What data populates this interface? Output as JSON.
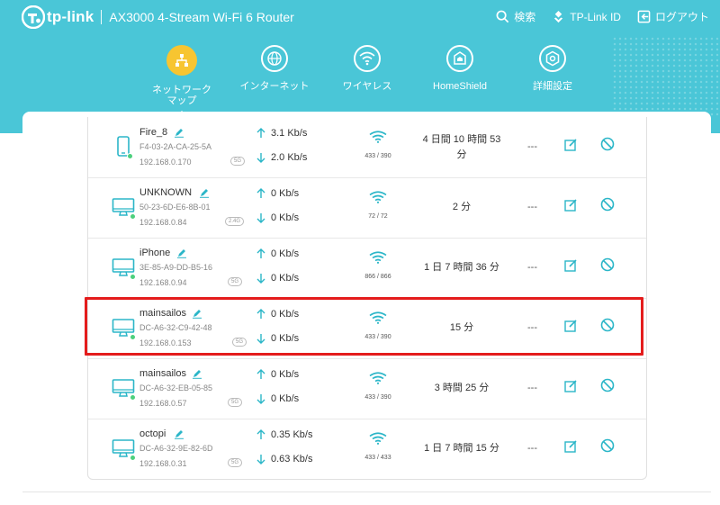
{
  "header": {
    "logo_text": "tp-link",
    "product": "AX3000 4-Stream Wi-Fi 6 Router",
    "actions": [
      {
        "label": "検索",
        "icon": "search-icon"
      },
      {
        "label": "TP-Link ID",
        "icon": "user-id-icon"
      },
      {
        "label": "ログアウト",
        "icon": "logout-icon"
      }
    ]
  },
  "nav": {
    "items": [
      {
        "label": "ネットワーク\nマップ",
        "icon": "network-map-icon",
        "active": true
      },
      {
        "label": "インターネット",
        "icon": "globe-icon"
      },
      {
        "label": "ワイヤレス",
        "icon": "wifi-icon"
      },
      {
        "label": "HomeShield",
        "icon": "homeshield-icon"
      },
      {
        "label": "詳細設定",
        "icon": "advanced-settings-icon"
      }
    ]
  },
  "devices": [
    {
      "name": "Fire_8",
      "mac": "F4-03-2A-CA-25-5A",
      "ip": "192.168.0.170",
      "band": "5G",
      "type": "phone",
      "up": "3.1 Kb/s",
      "down": "2.0 Kb/s",
      "rate": "433 / 390",
      "time": "4 日間 10 時間 53 分",
      "extra": "---"
    },
    {
      "name": "UNKNOWN",
      "mac": "50-23-6D-E6-8B-01",
      "ip": "192.168.0.84",
      "band": "2.4G",
      "type": "pc",
      "up": "0 Kb/s",
      "down": "0 Kb/s",
      "rate": "72 / 72",
      "time": "2 分",
      "extra": "---"
    },
    {
      "name": "iPhone",
      "mac": "3E-85-A9-DD-B5-16",
      "ip": "192.168.0.94",
      "band": "5G",
      "type": "pc",
      "up": "0 Kb/s",
      "down": "0 Kb/s",
      "rate": "866 / 866",
      "time": "1 日 7 時間 36 分",
      "extra": "---"
    },
    {
      "name": "mainsailos",
      "mac": "DC-A6-32-C9-42-48",
      "ip": "192.168.0.153",
      "band": "5G",
      "type": "pc",
      "up": "0 Kb/s",
      "down": "0 Kb/s",
      "rate": "433 / 390",
      "time": "15 分",
      "extra": "---"
    },
    {
      "name": "mainsailos",
      "mac": "DC-A6-32-EB-05-85",
      "ip": "192.168.0.57",
      "band": "5G",
      "type": "pc",
      "up": "0 Kb/s",
      "down": "0 Kb/s",
      "rate": "433 / 390",
      "time": "3 時間 25 分",
      "extra": "---"
    },
    {
      "name": "octopi",
      "mac": "DC-A6-32-9E-82-6D",
      "ip": "192.168.0.31",
      "band": "5G",
      "type": "pc",
      "up": "0.35 Kb/s",
      "down": "0.63 Kb/s",
      "rate": "433 / 433",
      "time": "1 日 7 時間 15 分",
      "extra": "---"
    }
  ],
  "colors": {
    "header": "#4ac6d7",
    "accent": "#2bb6c8",
    "active_nav": "#f7c531",
    "highlight": "#e41c1c",
    "online": "#4cd07d"
  }
}
